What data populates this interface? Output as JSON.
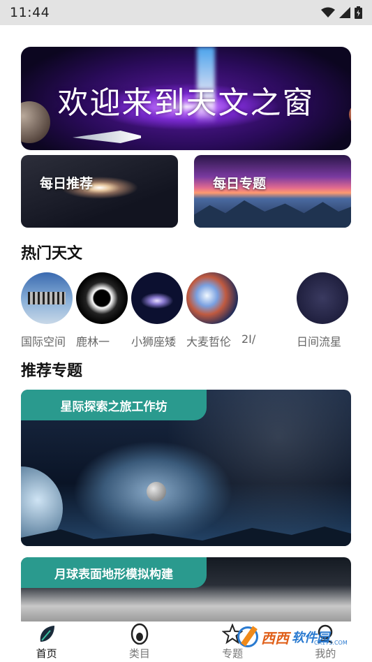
{
  "status_bar": {
    "time": "11:44"
  },
  "banner": {
    "title": "欢迎来到天文之窗"
  },
  "feature_cards": [
    {
      "label": "每日推荐"
    },
    {
      "label": "每日专题"
    }
  ],
  "hot_section": {
    "title": "热门天文",
    "items": [
      {
        "caption": "国际空间"
      },
      {
        "caption": "鹿林一"
      },
      {
        "caption": "小狮座矮"
      },
      {
        "caption": "大麦哲伦"
      },
      {
        "caption": "2I/"
      },
      {
        "caption": "日间流星"
      }
    ]
  },
  "topic_section": {
    "title": "推荐专题",
    "cards": [
      {
        "tag": "星际探索之旅工作坊"
      },
      {
        "tag": "月球表面地形模拟构建"
      }
    ]
  },
  "bottom_nav": {
    "items": [
      {
        "label": "首页",
        "icon": "leaf-icon",
        "active": true
      },
      {
        "label": "类目",
        "icon": "egg-icon",
        "active": false
      },
      {
        "label": "专题",
        "icon": "star-icon",
        "active": false
      },
      {
        "label": "我的",
        "icon": "person-icon",
        "active": false
      }
    ]
  },
  "watermark": {
    "text_a": "西西",
    "text_b": "软件园",
    "url": "CR173.COM"
  },
  "colors": {
    "accent_teal": "#2a9a8e",
    "status_bar_bg": "#e3e3e3"
  }
}
